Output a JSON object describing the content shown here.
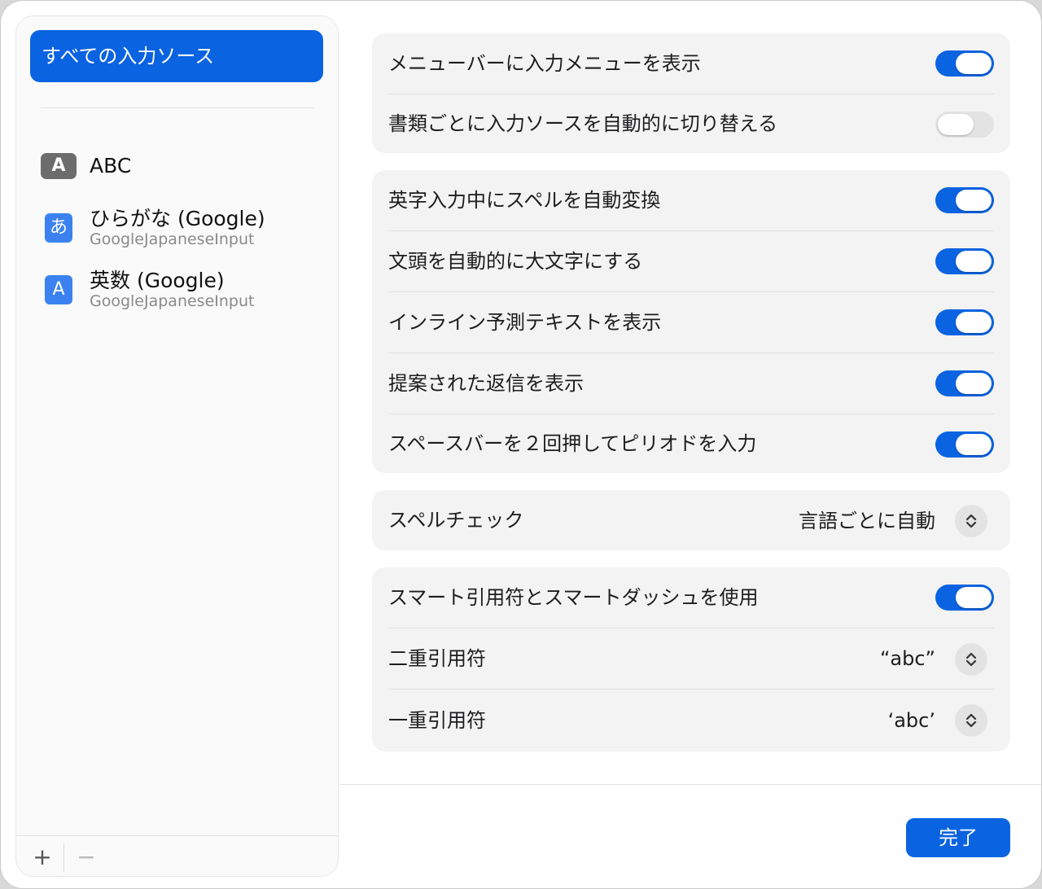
{
  "sidebar": {
    "header_label": "すべての入力ソース",
    "sources": [
      {
        "icon": "A",
        "title": "ABC",
        "subtitle": ""
      },
      {
        "icon": "あ",
        "title": "ひらがな (Google)",
        "subtitle": "GoogleJapaneseInput"
      },
      {
        "icon": "A",
        "title": "英数 (Google)",
        "subtitle": "GoogleJapaneseInput"
      }
    ],
    "add_label": "+",
    "remove_label": "−"
  },
  "groups": {
    "menu": {
      "show_input_menu": {
        "label": "メニューバーに入力メニューを表示",
        "on": true
      },
      "auto_switch": {
        "label": "書類ごとに入力ソースを自動的に切り替える",
        "on": false
      }
    },
    "typing": {
      "autocorrect": {
        "label": "英字入力中にスペルを自動変換",
        "on": true
      },
      "auto_capitalize": {
        "label": "文頭を自動的に大文字にする",
        "on": true
      },
      "inline_predictive": {
        "label": "インライン予測テキストを表示",
        "on": true
      },
      "suggested_replies": {
        "label": "提案された返信を表示",
        "on": true
      },
      "double_space_period": {
        "label": "スペースバーを２回押してピリオドを入力",
        "on": true
      }
    },
    "spelling": {
      "label": "スペルチェック",
      "value": "言語ごとに自動"
    },
    "quotes": {
      "smart_quotes": {
        "label": "スマート引用符とスマートダッシュを使用",
        "on": true
      },
      "double_quotes": {
        "label": "二重引用符",
        "value": "“abc”"
      },
      "single_quotes": {
        "label": "一重引用符",
        "value": "‘abc’"
      }
    }
  },
  "footer": {
    "done_label": "完了"
  },
  "colors": {
    "accent": "#0a63e1",
    "toggle_off": "#e3e3e3",
    "group_bg": "#f3f3f3"
  }
}
